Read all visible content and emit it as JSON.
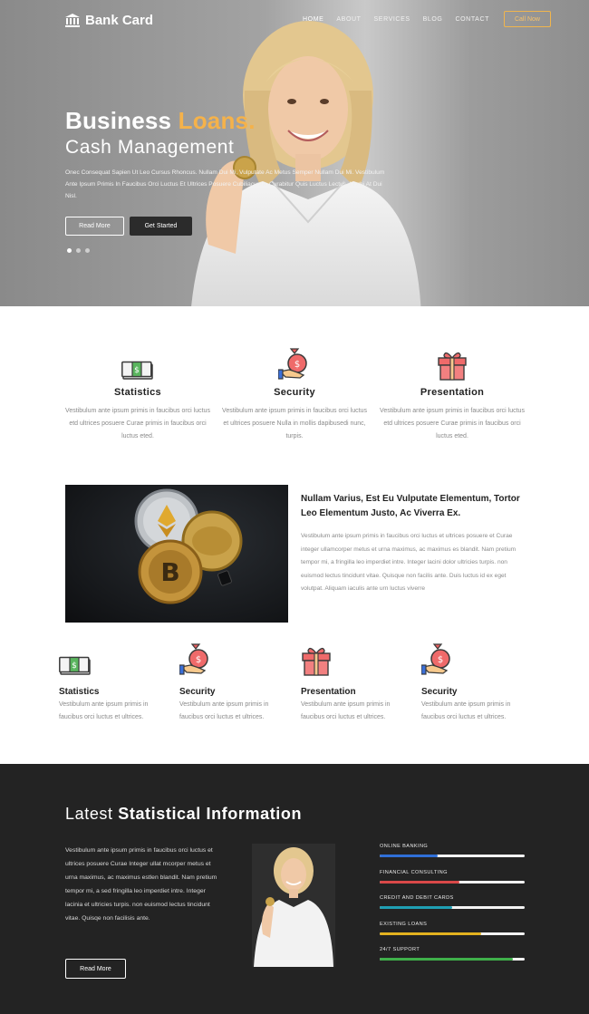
{
  "brand": {
    "name": "Bank Card"
  },
  "nav": {
    "items": [
      "HOME",
      "ABOUT",
      "SERVICES",
      "BLOG",
      "CONTACT"
    ],
    "active": "HOME",
    "cta": "Call Now"
  },
  "hero": {
    "title_main": "Business ",
    "title_accent": "Loans.",
    "subtitle": "Cash Management",
    "text": "Onec Consequat Sapien Ut Leo Cursus Rhoncus. Nullam Dui Mi, Vulputate Ac Metus Semper Nullam Dui Mi. Vestibulum Ante Ipsum Primis In Faucibus Orci Luctus Et Ultrices Posuere Cubiliacurae. Curabitur Quis Luctus Lectus. Morbi At Dui Nisl.",
    "btn_read": "Read More",
    "btn_start": "Get Started",
    "slides": 3,
    "active_slide": 1
  },
  "features": [
    {
      "icon": "money-icon",
      "title": "Statistics",
      "text": "Vestibulum ante ipsum primis in faucibus orci luctus etd ultrices posuere Curae primis in faucibus orci luctus eted."
    },
    {
      "icon": "money-bag-hand-icon",
      "title": "Security",
      "text": "Vestibulum ante ipsum primis in faucibus orci luctus et ultrices posuere Nulla in mollis dapibusedi nunc, turpis."
    },
    {
      "icon": "gift-icon",
      "title": "Presentation",
      "text": "Vestibulum ante ipsum primis in faucibus orci luctus etd ultrices posuere Curae primis in faucibus orci luctus eted."
    }
  ],
  "about": {
    "title": "Nullam Varius, Est Eu Vulputate Elementum, Tortor Leo Elementum Justo, Ac Viverra Ex.",
    "text": "Vestibulum ante ipsum primis in faucibus orci luctus et ultrices posuere et Curae integer ullamcorper metus et urna maximus, ac maximus es blandit. Nam pretium tempor mi, a fringilla leo imperdiet intre. Integer lacini dolor ultricies turpis. non euismod lectus tincidunt vitae. Quisque non facilis ante. Duis luctus id ex eget volutpat. Aliquam iaculis ante urn luctus viverre"
  },
  "small_features": [
    {
      "icon": "money-icon",
      "title": "Statistics",
      "text": "Vestibulum ante ipsum primis in faucibus orci luctus et ultrices."
    },
    {
      "icon": "money-bag-hand-icon",
      "title": "Security",
      "text": "Vestibulum ante ipsum primis in faucibus orci luctus et ultrices."
    },
    {
      "icon": "gift-icon",
      "title": "Presentation",
      "text": "Vestibulum ante ipsum primis in faucibus orci luctus et ultrices."
    },
    {
      "icon": "money-bag-hand-icon",
      "title": "Security",
      "text": "Vestibulum ante ipsum primis in faucibus orci luctus et ultrices."
    }
  ],
  "stats": {
    "title_light": "Latest ",
    "title_bold": "Statistical Information",
    "text": "Vestibulum ante ipsum primis in faucibus orci luctus et ultrices posuere Curae Integer ullat mcorper metus et urna maximus, ac maximus estlen blandit. Nam pretium tempor mi, a sed fringilla leo imperdiet intre. Integer lacinia et ultricies turpis. non euismod lectus tincidunt vitae. Quisqe non facilisis ante.",
    "btn": "Read More",
    "skills": [
      {
        "label": "ONLINE BANKING",
        "percent": 40,
        "color": "#2f6fd8"
      },
      {
        "label": "FINANCIAL CONSULTING",
        "percent": 55,
        "color": "#d94848"
      },
      {
        "label": "CREDIT AND DEBIT CARDS",
        "percent": 50,
        "color": "#1f9fb3"
      },
      {
        "label": "EXISTING LOANS",
        "percent": 70,
        "color": "#e3b21f"
      },
      {
        "label": "24/7 SUPPORT",
        "percent": 92,
        "color": "#3fb04a"
      }
    ]
  }
}
